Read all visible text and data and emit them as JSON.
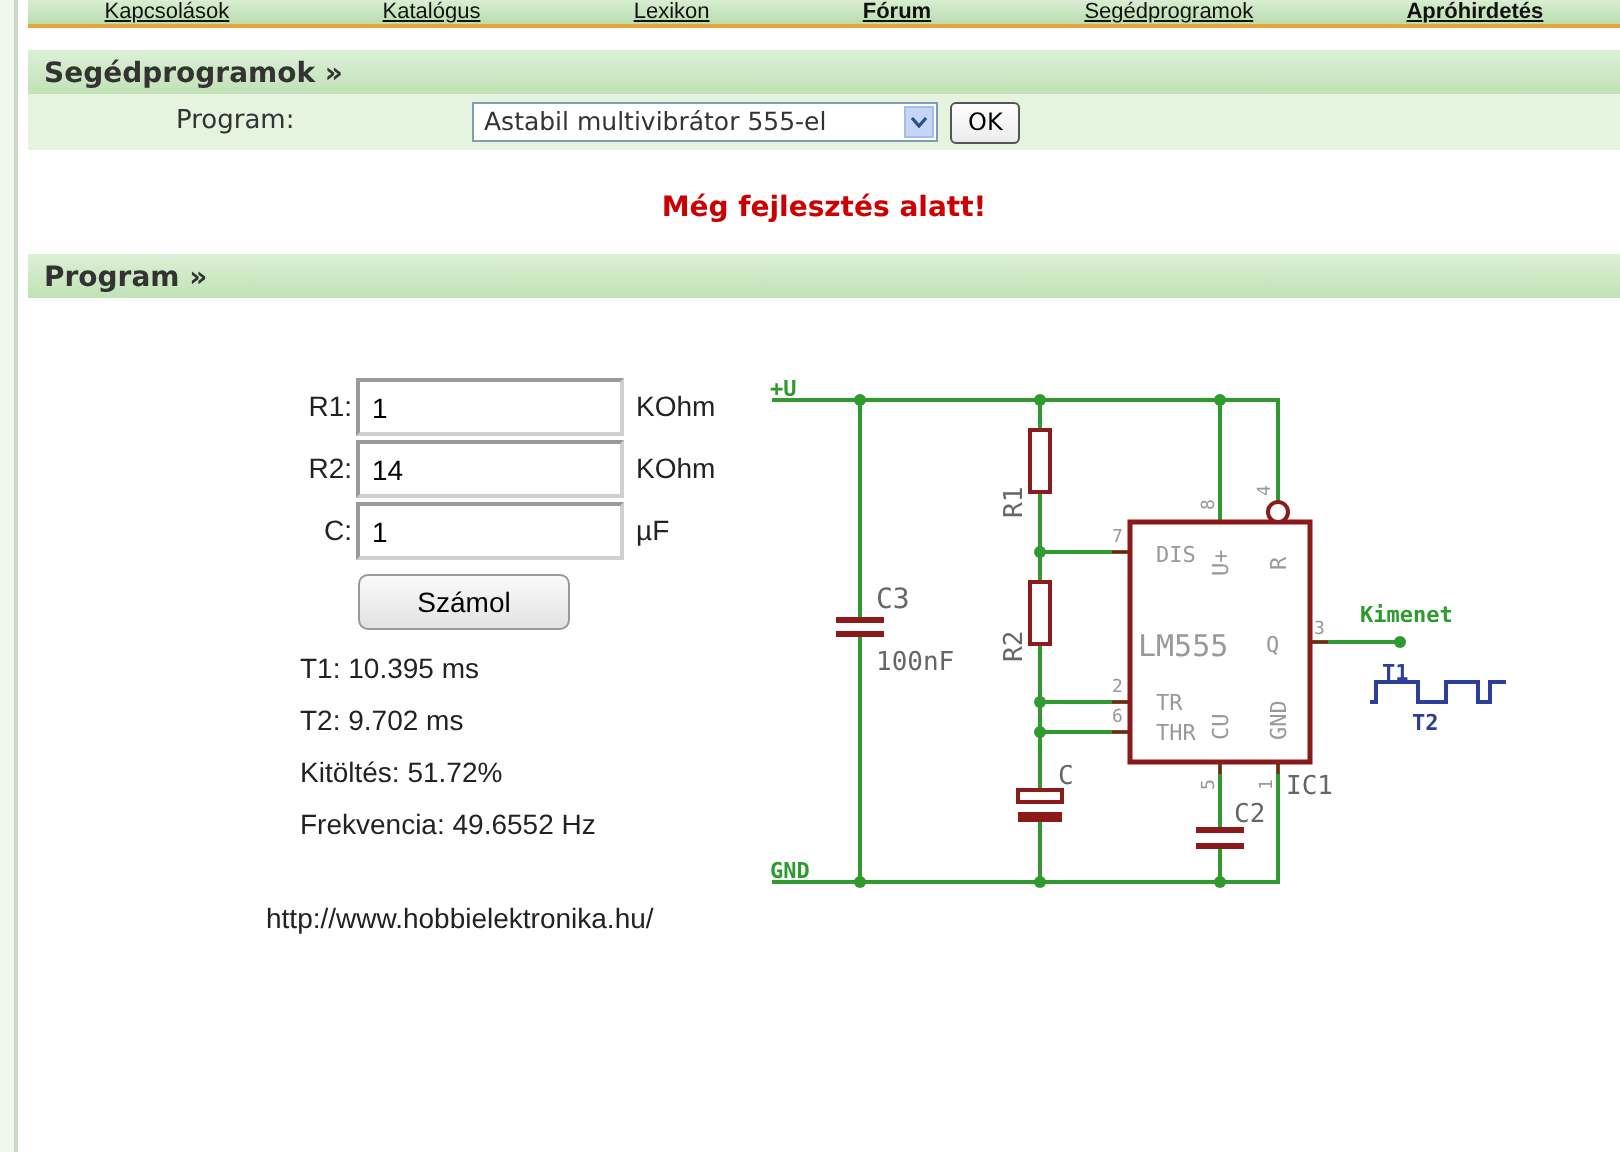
{
  "nav": [
    {
      "label": "Kapcsolások",
      "emphasized": false
    },
    {
      "label": "Katalógus",
      "emphasized": false
    },
    {
      "label": "Lexikon",
      "emphasized": false
    },
    {
      "label": "Fórum",
      "emphasized": true
    },
    {
      "label": "Segédprogramok",
      "emphasized": false
    },
    {
      "label": "Apróhirdetés",
      "emphasized": true
    }
  ],
  "tools_panel": {
    "title": "Segédprogramok »",
    "program_label": "Program:",
    "program_value": "Astabil multivibrátor 555-el",
    "ok_button": "OK"
  },
  "notice": "Még fejlesztés alatt!",
  "program_panel": {
    "title": "Program »",
    "inputs": [
      {
        "label": "R1:",
        "value": "1",
        "unit": "KOhm"
      },
      {
        "label": "R2:",
        "value": "14",
        "unit": "KOhm"
      },
      {
        "label": "C:",
        "value": "1",
        "unit": "µF"
      }
    ],
    "calc_button": "Számol",
    "results": [
      "T1: 10.395 ms",
      "T2: 9.702 ms",
      "Kitöltés: 51.72%",
      "Frekvencia: 49.6552 Hz"
    ],
    "url": "http://www.hobbielektronika.hu/"
  },
  "schematic": {
    "net_labels": [
      "+U",
      "GND",
      "Kimenet"
    ],
    "part_labels": [
      "C3",
      "100nF",
      "R1",
      "R2",
      "C",
      "IC1",
      "C2"
    ],
    "chip_labels": [
      "DIS",
      "U+",
      "R",
      "LM555",
      "Q",
      "TR",
      "THR",
      "CU",
      "GND"
    ],
    "pin_numbers": [
      "7",
      "8",
      "4",
      "3",
      "2",
      "6",
      "5",
      "1"
    ],
    "wave_labels": [
      "T1",
      "T2"
    ]
  }
}
